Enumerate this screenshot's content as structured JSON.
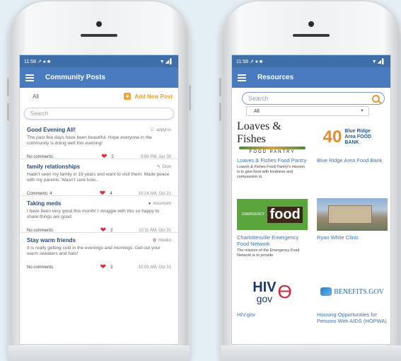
{
  "status_time": "11:58",
  "status_icons_left": "↗ ● ■",
  "status_icons_right": "▼◢▌",
  "posts_screen": {
    "title": "Community Posts",
    "filter_value": "All",
    "add_post_label": "Add New Post",
    "search_placeholder": "Search",
    "posts": [
      {
        "title": "Good Evening All!",
        "author": "appyrss",
        "author_icon": "thumbs-up-icon",
        "body": "The past few days have been beautiful. Hope everyone in the community is doing well this evening!",
        "comments": "No comments",
        "likes": "2",
        "time": "8:09 PM, Apr 30"
      },
      {
        "title": "family relationships",
        "author": "Dion",
        "author_icon": "chat-icon",
        "body": "Hadn't seen my family in 19 years and want to visit them. Made peace with my parents. Wasn't sure how...",
        "comments": "Comments: 4",
        "likes": "4",
        "time": "10:16 AM, Oct 21"
      },
      {
        "title": "Taking meds",
        "author": "missmom",
        "author_icon": "dot-icon",
        "body": "I have been very good this month! I struggle with this so happy to share things are good",
        "comments": "No comments",
        "likes": "2",
        "time": "10:11 AM, Oct 31"
      },
      {
        "title": "Stay warm friends",
        "author": "moeko",
        "author_icon": "flower-icon",
        "body": "It is really getting cold in the evenings and mornings. Get out your warm sweaters and hats!",
        "comments": "No comments",
        "likes": "3",
        "time": "10:03 AM, Oct 31"
      }
    ]
  },
  "resources_screen": {
    "title": "Resources",
    "search_placeholder": "Search",
    "filter_value": "All",
    "resources": [
      {
        "name": "Loaves & Fishes Food Pantry",
        "logo_text": "Loaves & Fishes",
        "logo_sub": "FOOD PANTRY",
        "description": "Loaves & Fishes Food Pantry's mission is to give food with kindness and compassion to"
      },
      {
        "name": "Blue Ridge Area Food Bank",
        "logo_text": "40",
        "logo_sub": "Blue Ridge Area FOOD BANK",
        "description": ""
      },
      {
        "name": "Charlottesville Emergency Food Network",
        "logo_text": "food",
        "logo_sub": "EMERGENCY",
        "description": "The mission of the Emergency Food Network is to provide"
      },
      {
        "name": "Ryan White Clinic",
        "logo_text": "",
        "logo_sub": "",
        "description": ""
      },
      {
        "name": "HIV.gov",
        "logo_text": "HIV",
        "logo_sub": "gov",
        "description": ""
      },
      {
        "name": "Housing Opportunities for Persons With AIDS (HOPWA)",
        "logo_text": "BENEFITS.GOV",
        "logo_sub": "",
        "description": ""
      }
    ]
  },
  "colors": {
    "appbar": "#4a7bbf",
    "statusbar": "#3e6fa8",
    "accent": "#f0a53a",
    "heart": "#d82c3a",
    "link": "#3b73b8"
  }
}
